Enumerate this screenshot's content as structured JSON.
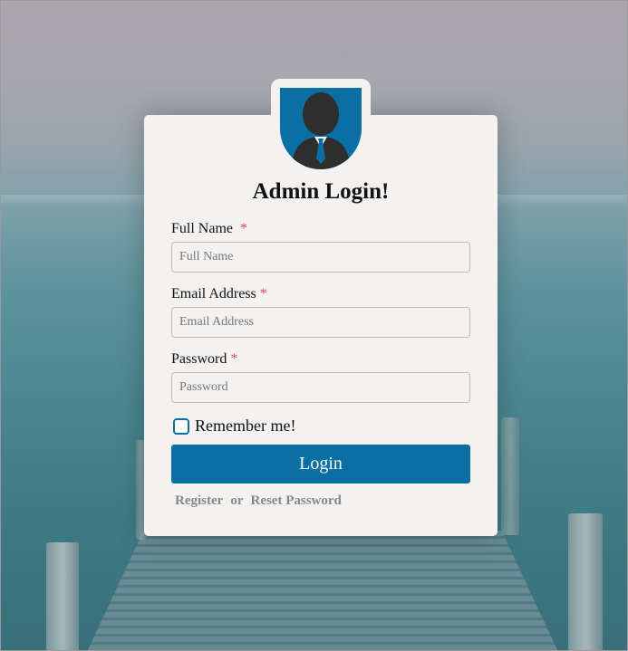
{
  "login": {
    "title": "Admin Login!",
    "full_name": {
      "label": "Full Name",
      "required_mark": "*",
      "placeholder": "Full Name"
    },
    "email": {
      "label": "Email Address",
      "required_mark": "*",
      "placeholder": "Email Address"
    },
    "password": {
      "label": "Password",
      "required_mark": "*",
      "placeholder": "Password"
    },
    "remember_label": "Remember me!",
    "login_label": "Login",
    "register_label": "Register",
    "or_label": "or",
    "reset_label": "Reset Password"
  },
  "colors": {
    "accent": "#0a6fa2",
    "card": "#f3f2f1",
    "required": "#e04a4a"
  },
  "icons": {
    "avatar": "user-silhouette-icon"
  }
}
